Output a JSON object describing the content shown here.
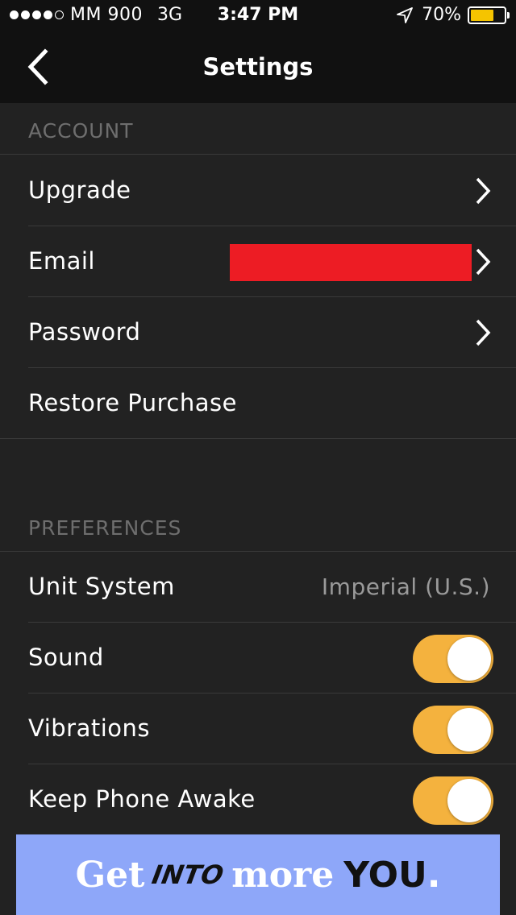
{
  "status_bar": {
    "signal_dots": 5,
    "signal_filled": 4,
    "carrier": "MM 900",
    "network": "3G",
    "time": "3:47 PM",
    "battery_text": "70%",
    "battery_level": 0.7,
    "battery_color": "#f5c400"
  },
  "nav": {
    "back_icon": "chevron-left-icon",
    "title": "Settings"
  },
  "account": {
    "header": "ACCOUNT",
    "rows": [
      {
        "label": "Upgrade",
        "has_chevron": true
      },
      {
        "label": "Email",
        "has_chevron": true
      },
      {
        "label": "Password",
        "has_chevron": true
      },
      {
        "label": "Restore Purchase",
        "has_chevron": false
      }
    ]
  },
  "preferences": {
    "header": "PREFERENCES",
    "unit_system": {
      "label": "Unit System",
      "value": "Imperial (U.S.)"
    },
    "sound": {
      "label": "Sound",
      "on": true
    },
    "vibrations": {
      "label": "Vibrations",
      "on": true
    },
    "keep_awake": {
      "label": "Keep Phone Awake",
      "on": true
    }
  },
  "ad": {
    "word1": "Get",
    "word2": "INTO",
    "word3": "more",
    "word4": "YOU",
    "punct": ".",
    "bg_color": "#8ea7f9"
  },
  "colors": {
    "toggle_on": "#f4b23e",
    "redaction": "#ed1c24"
  }
}
